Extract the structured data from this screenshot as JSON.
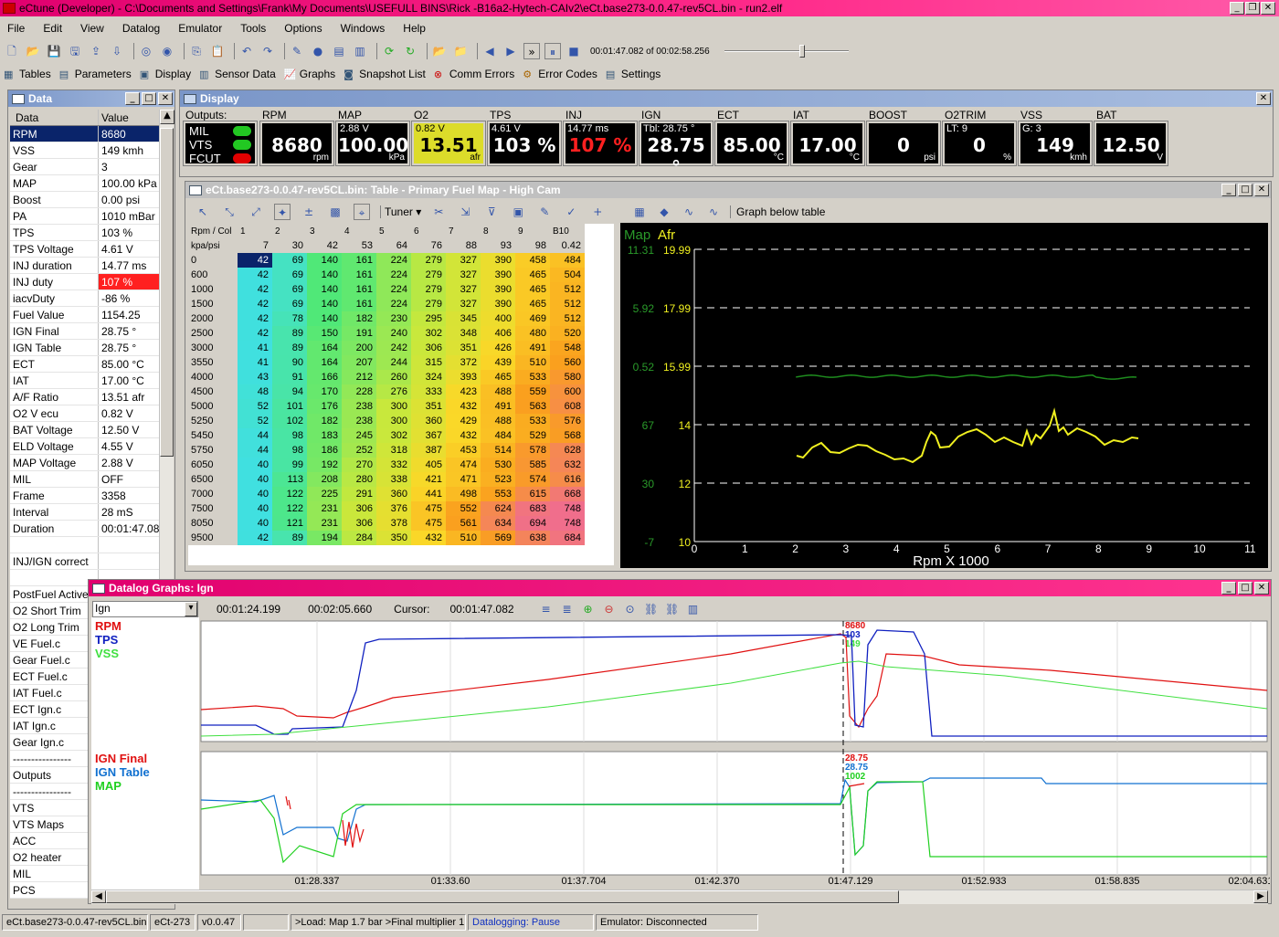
{
  "window": {
    "title": "eCtune (Developer) - C:\\Documents and Settings\\Frank\\My Documents\\USEFULL BINS\\Rick -B16a2-Hytech-CAIv2\\eCt.base273-0.0.47-rev5CL.bin - run2.elf"
  },
  "menu": [
    "File",
    "Edit",
    "View",
    "Datalog",
    "Emulator",
    "Tools",
    "Options",
    "Windows",
    "Help"
  ],
  "toolbar": {
    "time_position": "00:01:47.082 of 00:02:58.256"
  },
  "toolbar2": [
    "Tables",
    "Parameters",
    "Display",
    "Sensor Data",
    "Graphs",
    "Snapshot List",
    "Comm Errors",
    "Error Codes",
    "Settings"
  ],
  "data_panel": {
    "title": "Data",
    "col_name": "Data",
    "col_value": "Value",
    "rows": [
      {
        "n": "RPM",
        "v": "8680"
      },
      {
        "n": "VSS",
        "v": "149 kmh"
      },
      {
        "n": "Gear",
        "v": "3"
      },
      {
        "n": "MAP",
        "v": "100.00 kPa"
      },
      {
        "n": "Boost",
        "v": "0.00 psi"
      },
      {
        "n": "PA",
        "v": "1010 mBar"
      },
      {
        "n": "TPS",
        "v": "103 %"
      },
      {
        "n": "TPS Voltage",
        "v": "4.61 V"
      },
      {
        "n": "INJ duration",
        "v": "14.77 ms"
      },
      {
        "n": "INJ duty",
        "v": "107 %"
      },
      {
        "n": "iacvDuty",
        "v": "-86 %"
      },
      {
        "n": "Fuel Value",
        "v": "1154.25"
      },
      {
        "n": "IGN Final",
        "v": "28.75 °"
      },
      {
        "n": "IGN Table",
        "v": "28.75 °"
      },
      {
        "n": "ECT",
        "v": "85.00 °C"
      },
      {
        "n": "IAT",
        "v": "17.00 °C"
      },
      {
        "n": "A/F Ratio",
        "v": "13.51 afr"
      },
      {
        "n": "O2 V ecu",
        "v": "0.82 V"
      },
      {
        "n": "BAT Voltage",
        "v": "12.50 V"
      },
      {
        "n": "ELD Voltage",
        "v": "4.55 V"
      },
      {
        "n": "MAP Voltage",
        "v": "2.88 V"
      },
      {
        "n": "MIL",
        "v": "OFF"
      },
      {
        "n": "Frame",
        "v": "3358"
      },
      {
        "n": "Interval",
        "v": "28 mS"
      },
      {
        "n": "Duration",
        "v": "00:01:47.08"
      },
      {
        "n": "",
        "v": ""
      },
      {
        "n": "INJ/IGN correct",
        "v": ""
      },
      {
        "n": "",
        "v": ""
      },
      {
        "n": "PostFuel Active",
        "v": ""
      },
      {
        "n": "O2 Short Trim",
        "v": ""
      },
      {
        "n": "O2 Long Trim",
        "v": ""
      },
      {
        "n": "VE Fuel.c",
        "v": ""
      },
      {
        "n": "Gear Fuel.c",
        "v": ""
      },
      {
        "n": "ECT Fuel.c",
        "v": ""
      },
      {
        "n": "IAT Fuel.c",
        "v": ""
      },
      {
        "n": "ECT Ign.c",
        "v": ""
      },
      {
        "n": "IAT Ign.c",
        "v": ""
      },
      {
        "n": "Gear Ign.c",
        "v": ""
      },
      {
        "n": "----------------",
        "v": ""
      },
      {
        "n": "Outputs",
        "v": ""
      },
      {
        "n": "----------------",
        "v": ""
      },
      {
        "n": "VTS",
        "v": ""
      },
      {
        "n": "VTS Maps",
        "v": ""
      },
      {
        "n": "ACC",
        "v": ""
      },
      {
        "n": "O2 heater",
        "v": ""
      },
      {
        "n": "MIL",
        "v": ""
      },
      {
        "n": "PCS",
        "v": ""
      }
    ]
  },
  "display": {
    "title": "Display",
    "outputs_label": "Outputs:",
    "outputs": [
      "MIL",
      "VTS",
      "FCUT"
    ],
    "output_colors": [
      "#22c822",
      "#22c822",
      "#e00000"
    ],
    "gauges": [
      {
        "label": "RPM",
        "value": "8680",
        "small": "",
        "unit": "rpm",
        "bg": "#000",
        "fg": "#fff"
      },
      {
        "label": "MAP",
        "value": "100.00",
        "small": "2.88 V",
        "unit": "kPa",
        "bg": "#000",
        "fg": "#fff"
      },
      {
        "label": "O2",
        "value": "13.51",
        "small": "0.82 V",
        "unit": "afr",
        "bg": "#dcdc2a",
        "fg": "#000"
      },
      {
        "label": "TPS",
        "value": "103 %",
        "small": "4.61 V",
        "unit": "",
        "bg": "#000",
        "fg": "#fff"
      },
      {
        "label": "INJ",
        "value": "107 %",
        "small": "14.77 ms",
        "unit": "",
        "bg": "#000",
        "fg": "#ff2020"
      },
      {
        "label": "IGN",
        "value": "28.75 °",
        "small": "Tbl: 28.75 °",
        "unit": "",
        "bg": "#000",
        "fg": "#fff"
      },
      {
        "label": "ECT",
        "value": "85.00",
        "small": "",
        "unit": "°C",
        "bg": "#000",
        "fg": "#fff"
      },
      {
        "label": "IAT",
        "value": "17.00",
        "small": "",
        "unit": "°C",
        "bg": "#000",
        "fg": "#fff"
      },
      {
        "label": "BOOST",
        "value": "0",
        "small": "",
        "unit": "psi",
        "bg": "#000",
        "fg": "#fff"
      },
      {
        "label": "O2TRIM",
        "value": "0",
        "small": "LT: 9",
        "unit": "%",
        "bg": "#000",
        "fg": "#fff"
      },
      {
        "label": "VSS",
        "value": "149",
        "small": "G: 3",
        "unit": "kmh",
        "bg": "#000",
        "fg": "#fff"
      },
      {
        "label": "BAT",
        "value": "12.50",
        "small": "",
        "unit": "V",
        "bg": "#000",
        "fg": "#fff"
      }
    ]
  },
  "table_window": {
    "title": "eCt.base273-0.0.47-rev5CL.bin: Table - Primary Fuel Map - High Cam",
    "mode": "Tuner",
    "graph_below": "Graph below table",
    "corner1": "Rpm / Col",
    "corner2": "kpa/psi",
    "col_index": [
      "1",
      "2",
      "3",
      "4",
      "5",
      "6",
      "7",
      "8",
      "9",
      "B10"
    ],
    "col_kpa": [
      "7",
      "30",
      "42",
      "53",
      "64",
      "76",
      "88",
      "93",
      "98",
      "0.42"
    ],
    "rpm": [
      "0",
      "600",
      "1000",
      "1500",
      "2000",
      "2500",
      "3000",
      "3550",
      "4000",
      "4500",
      "5000",
      "5250",
      "5450",
      "5750",
      "6050",
      "6500",
      "7000",
      "7500",
      "8050",
      "9500"
    ],
    "cells": [
      [
        42,
        69,
        140,
        161,
        224,
        279,
        327,
        390,
        458,
        484
      ],
      [
        42,
        69,
        140,
        161,
        224,
        279,
        327,
        390,
        465,
        504
      ],
      [
        42,
        69,
        140,
        161,
        224,
        279,
        327,
        390,
        465,
        512
      ],
      [
        42,
        69,
        140,
        161,
        224,
        279,
        327,
        390,
        465,
        512
      ],
      [
        42,
        78,
        140,
        182,
        230,
        295,
        345,
        400,
        469,
        512
      ],
      [
        42,
        89,
        150,
        191,
        240,
        302,
        348,
        406,
        480,
        520
      ],
      [
        41,
        89,
        164,
        200,
        242,
        306,
        351,
        426,
        491,
        548
      ],
      [
        41,
        90,
        164,
        207,
        244,
        315,
        372,
        439,
        510,
        560
      ],
      [
        43,
        91,
        166,
        212,
        260,
        324,
        393,
        465,
        533,
        580
      ],
      [
        48,
        94,
        170,
        228,
        276,
        333,
        423,
        488,
        559,
        600
      ],
      [
        52,
        101,
        176,
        238,
        300,
        351,
        432,
        491,
        563,
        608
      ],
      [
        52,
        102,
        182,
        238,
        300,
        360,
        429,
        488,
        533,
        576
      ],
      [
        44,
        98,
        183,
        245,
        302,
        367,
        432,
        484,
        529,
        568
      ],
      [
        44,
        98,
        186,
        252,
        318,
        387,
        453,
        514,
        578,
        628
      ],
      [
        40,
        99,
        192,
        270,
        332,
        405,
        474,
        530,
        585,
        632
      ],
      [
        40,
        113,
        208,
        280,
        338,
        421,
        471,
        523,
        574,
        616
      ],
      [
        40,
        122,
        225,
        291,
        360,
        441,
        498,
        553,
        615,
        668
      ],
      [
        40,
        122,
        231,
        306,
        376,
        475,
        552,
        624,
        683,
        748
      ],
      [
        40,
        121,
        231,
        306,
        378,
        475,
        561,
        634,
        694,
        748
      ],
      [
        42,
        89,
        194,
        284,
        350,
        432,
        510,
        569,
        638,
        684
      ]
    ]
  },
  "map_graph": {
    "legend_map": "Map",
    "legend_afr": "Afr",
    "y_left": [
      "11.31",
      "5.92",
      "0.52",
      "67",
      "30",
      "-7"
    ],
    "y_right": [
      "19.99",
      "17.99",
      "15.99",
      "14",
      "12",
      "10"
    ],
    "x_ticks": [
      "0",
      "1",
      "2",
      "3",
      "4",
      "5",
      "6",
      "7",
      "8",
      "9",
      "10",
      "11"
    ],
    "x_label": "Rpm X 1000",
    "colors": {
      "map": "#1e8c1e",
      "afr": "#f0f020"
    }
  },
  "datalog": {
    "title": "Datalog Graphs: Ign",
    "preset": "Ign",
    "start": "00:01:24.199",
    "end": "00:02:05.660",
    "cursor_label": "Cursor:",
    "cursor": "00:01:47.082",
    "top_legend": [
      {
        "name": "RPM",
        "color": "#e01010"
      },
      {
        "name": "TPS",
        "color": "#1020c0"
      },
      {
        "name": "VSS",
        "color": "#40e040"
      }
    ],
    "top_cursor_vals": [
      "8680",
      "103",
      "149"
    ],
    "bottom_legend": [
      {
        "name": "IGN Final",
        "color": "#e01010"
      },
      {
        "name": "IGN Table",
        "color": "#1070d0"
      },
      {
        "name": "MAP",
        "color": "#20d020"
      }
    ],
    "bottom_cursor_vals": [
      "28.75",
      "28.75",
      "1002"
    ],
    "x_ticks": [
      "01:28.337",
      "01:33.60",
      "01:37.704",
      "01:42.370",
      "01:47.129",
      "01:52.933",
      "01:58.835",
      "02:04.631"
    ]
  },
  "statusbar": [
    "eCt.base273-0.0.47-rev5CL.bin",
    "eCt-273",
    "v0.0.47",
    "",
    ">Load: Map 1.7 bar >Final multiplier 1",
    "Datalogging: Pause",
    "Emulator: Disconnected"
  ]
}
